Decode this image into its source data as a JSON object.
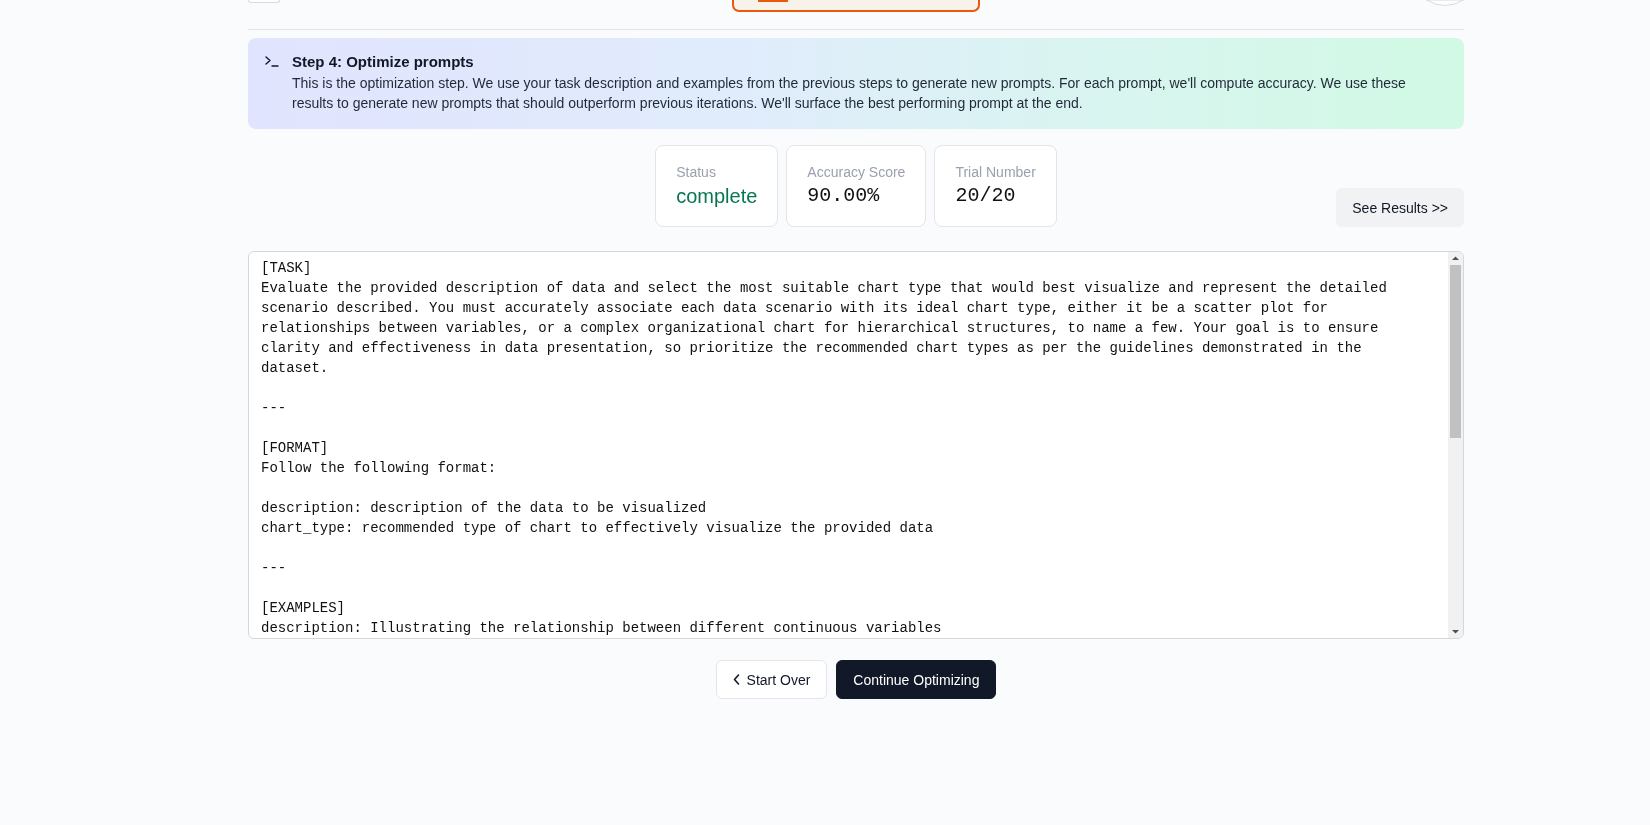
{
  "banner": {
    "title": "Step 4: Optimize prompts",
    "description": "This is the optimization step. We use your task description and examples from the previous steps to generate new prompts. For each prompt, we'll compute accuracy. We use these results to generate new prompts that should outperform previous iterations. We'll surface the best performing prompt at the end."
  },
  "stats": [
    {
      "label": "Status",
      "value": "complete",
      "kind": "status"
    },
    {
      "label": "Accuracy Score",
      "value": "90.00%",
      "kind": "metric"
    },
    {
      "label": "Trial Number",
      "value": "20/20",
      "kind": "metric"
    }
  ],
  "results_button": {
    "label": "See Results >>"
  },
  "prompt_editor": {
    "value": "[TASK]\nEvaluate the provided description of data and select the most suitable chart type that would best visualize and represent the detailed\nscenario described. You must accurately associate each data scenario with its ideal chart type, either it be a scatter plot for\nrelationships between variables, or a complex organizational chart for hierarchical structures, to name a few. Your goal is to ensure\nclarity and effectiveness in data presentation, so prioritize the recommended chart types as per the guidelines demonstrated in the\ndataset.\n\n---\n\n[FORMAT]\nFollow the following format:\n\ndescription: description of the data to be visualized\nchart_type: recommended type of chart to effectively visualize the provided data\n\n---\n\n[EXAMPLES]\ndescription: Illustrating the relationship between different continuous variables"
  },
  "buttons": [
    {
      "label": "Start Over",
      "kind": "back"
    },
    {
      "label": "Continue Optimizing",
      "kind": "primary"
    }
  ]
}
